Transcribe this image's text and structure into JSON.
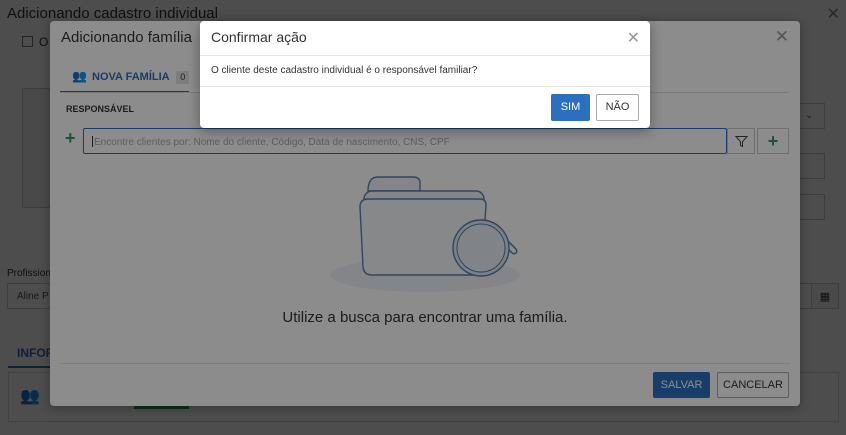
{
  "background": {
    "title": "Adicionando cadastro individual",
    "close_icon": "close-icon",
    "checkbox_label": "O",
    "select_icon": "chevron-down-icon",
    "professional_label": "Profission",
    "professional_value": "Aline P",
    "calendar_icon": "calendar-icon",
    "info_tab": "INFOR",
    "card_icon": "users-icon"
  },
  "family_modal": {
    "title": "Adicionando família",
    "close_icon": "close-icon",
    "tab": {
      "icon": "users-icon",
      "label": "NOVA FAMÍLIA",
      "count": "0"
    },
    "section_label": "RESPONSÁVEL",
    "add_icon": "plus-icon",
    "search_placeholder": "Encontre clientes por: Nome do cliente, Código, Data de nascimento, CNS, CPF",
    "filter_icon": "filter-icon",
    "empty_illustration": "folder-search-icon",
    "empty_text": "Utilize a busca para encontrar uma família.",
    "save_label": "SALVAR",
    "cancel_label": "CANCELAR"
  },
  "confirm_dialog": {
    "title": "Confirmar ação",
    "close_icon": "close-icon",
    "message": "O cliente deste cadastro individual é o responsável familiar?",
    "yes_label": "SIM",
    "no_label": "NÃO"
  },
  "colors": {
    "primary": "#2c6fbf",
    "add_green": "#2e9e5b",
    "overlay": "rgba(0,0,0,0.45)"
  }
}
